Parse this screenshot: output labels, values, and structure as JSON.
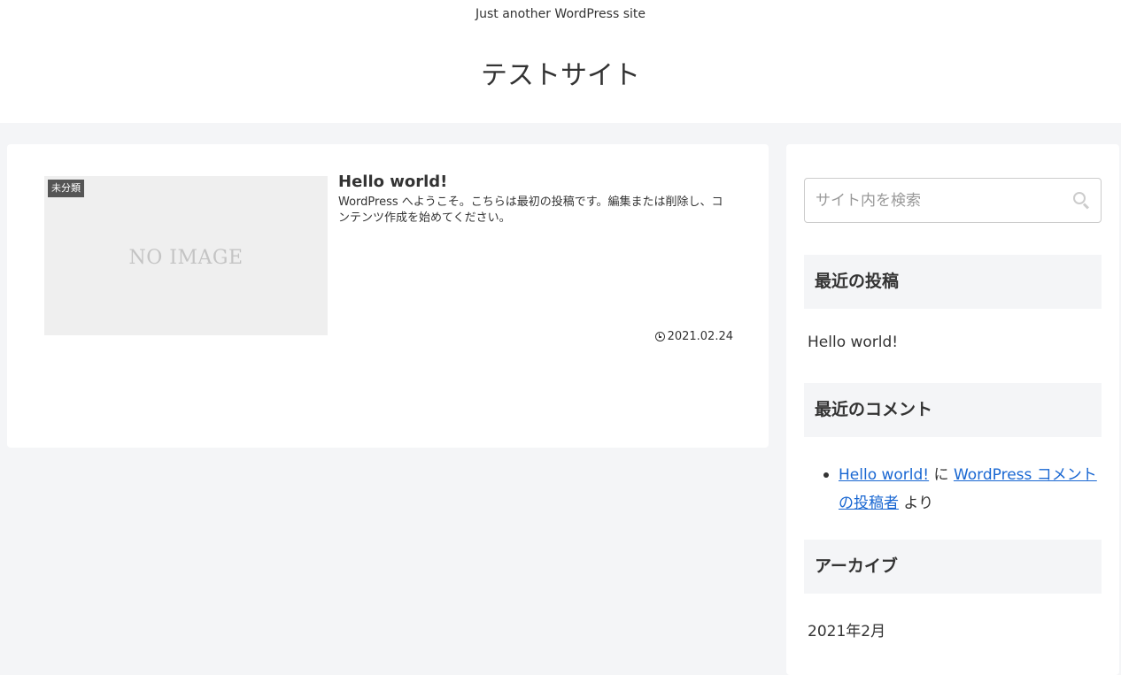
{
  "header": {
    "tagline": "Just another WordPress site",
    "site_title": "テストサイト"
  },
  "post": {
    "category": "未分類",
    "no_image_text": "NO IMAGE",
    "title": "Hello world!",
    "snippet": "WordPress へようこそ。こちらは最初の投稿です。編集または削除し、コンテンツ作成を始めてください。",
    "date": "2021.02.24"
  },
  "sidebar": {
    "search_placeholder": "サイト内を検索",
    "recent_posts": {
      "title": "最近の投稿",
      "items": [
        "Hello world!"
      ]
    },
    "recent_comments": {
      "title": "最近のコメント",
      "post_link": "Hello world!",
      "connector": " に ",
      "author_link": "WordPress コメントの投稿者",
      "suffix": " より"
    },
    "archives": {
      "title": "アーカイブ",
      "items": [
        "2021年2月"
      ]
    }
  }
}
